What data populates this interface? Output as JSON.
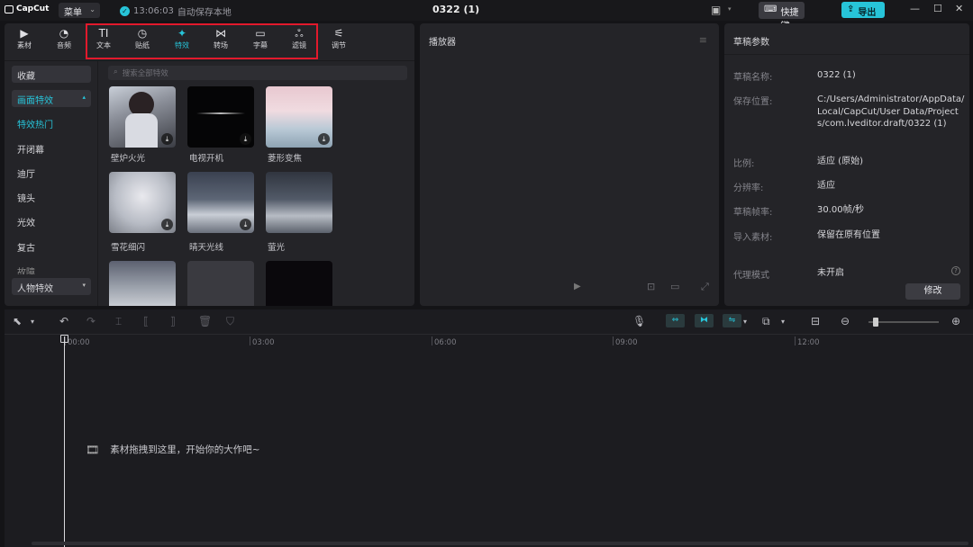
{
  "titlebar": {
    "app_name": "CapCut",
    "menu_label": "菜单",
    "save_time": "13:06:03",
    "save_text": "自动保存本地",
    "project_title": "0322 (1)",
    "shortcuts_label": "快捷键",
    "export_label": "导出"
  },
  "toolbar": {
    "tabs": [
      {
        "label": "素材",
        "icon": "media-icon"
      },
      {
        "label": "音频",
        "icon": "audio-icon"
      },
      {
        "label": "文本",
        "icon": "text-icon"
      },
      {
        "label": "贴纸",
        "icon": "sticker-icon"
      },
      {
        "label": "特效",
        "icon": "effects-icon"
      },
      {
        "label": "转场",
        "icon": "transition-icon"
      },
      {
        "label": "字幕",
        "icon": "caption-icon"
      },
      {
        "label": "滤镜",
        "icon": "filter-icon"
      },
      {
        "label": "调节",
        "icon": "adjust-icon"
      }
    ],
    "active_tab": "特效"
  },
  "sidebar": {
    "items": [
      "收藏",
      "画面特效",
      "特效热门",
      "开闭幕",
      "迪厅",
      "镜头",
      "光效",
      "复古",
      "故障"
    ],
    "bottom_item": "人物特效"
  },
  "search": {
    "placeholder": "搜索全部特效"
  },
  "effects": [
    {
      "label": "壁炉火光"
    },
    {
      "label": "电视开机"
    },
    {
      "label": "菱形变焦"
    },
    {
      "label": "雪花细闪"
    },
    {
      "label": "晴天光线"
    },
    {
      "label": "萤光"
    },
    {
      "label": ""
    },
    {
      "label": ""
    },
    {
      "label": ""
    }
  ],
  "player": {
    "title": "播放器"
  },
  "draft": {
    "title": "草稿参数",
    "params": [
      {
        "label": "草稿名称:",
        "value": "0322 (1)"
      },
      {
        "label": "保存位置:",
        "value": "C:/Users/Administrator/AppData/Local/CapCut/User Data/Projects/com.lveditor.draft/0322 (1)"
      },
      {
        "label": "比例:",
        "value": "适应 (原始)"
      },
      {
        "label": "分辨率:",
        "value": "适应"
      },
      {
        "label": "草稿帧率:",
        "value": "30.00帧/秒"
      },
      {
        "label": "导入素材:",
        "value": "保留在原有位置"
      },
      {
        "label": "代理模式",
        "value": "未开启"
      }
    ],
    "modify_label": "修改"
  },
  "timeline": {
    "ruler": [
      "00:00",
      "03:00",
      "06:00",
      "09:00",
      "12:00"
    ],
    "drop_hint": "素材拖拽到这里，开始你的大作吧~"
  },
  "colors": {
    "accent": "#27c4d9",
    "highlight_box": "#e2192c",
    "panel": "#242428",
    "background": "#141417"
  }
}
